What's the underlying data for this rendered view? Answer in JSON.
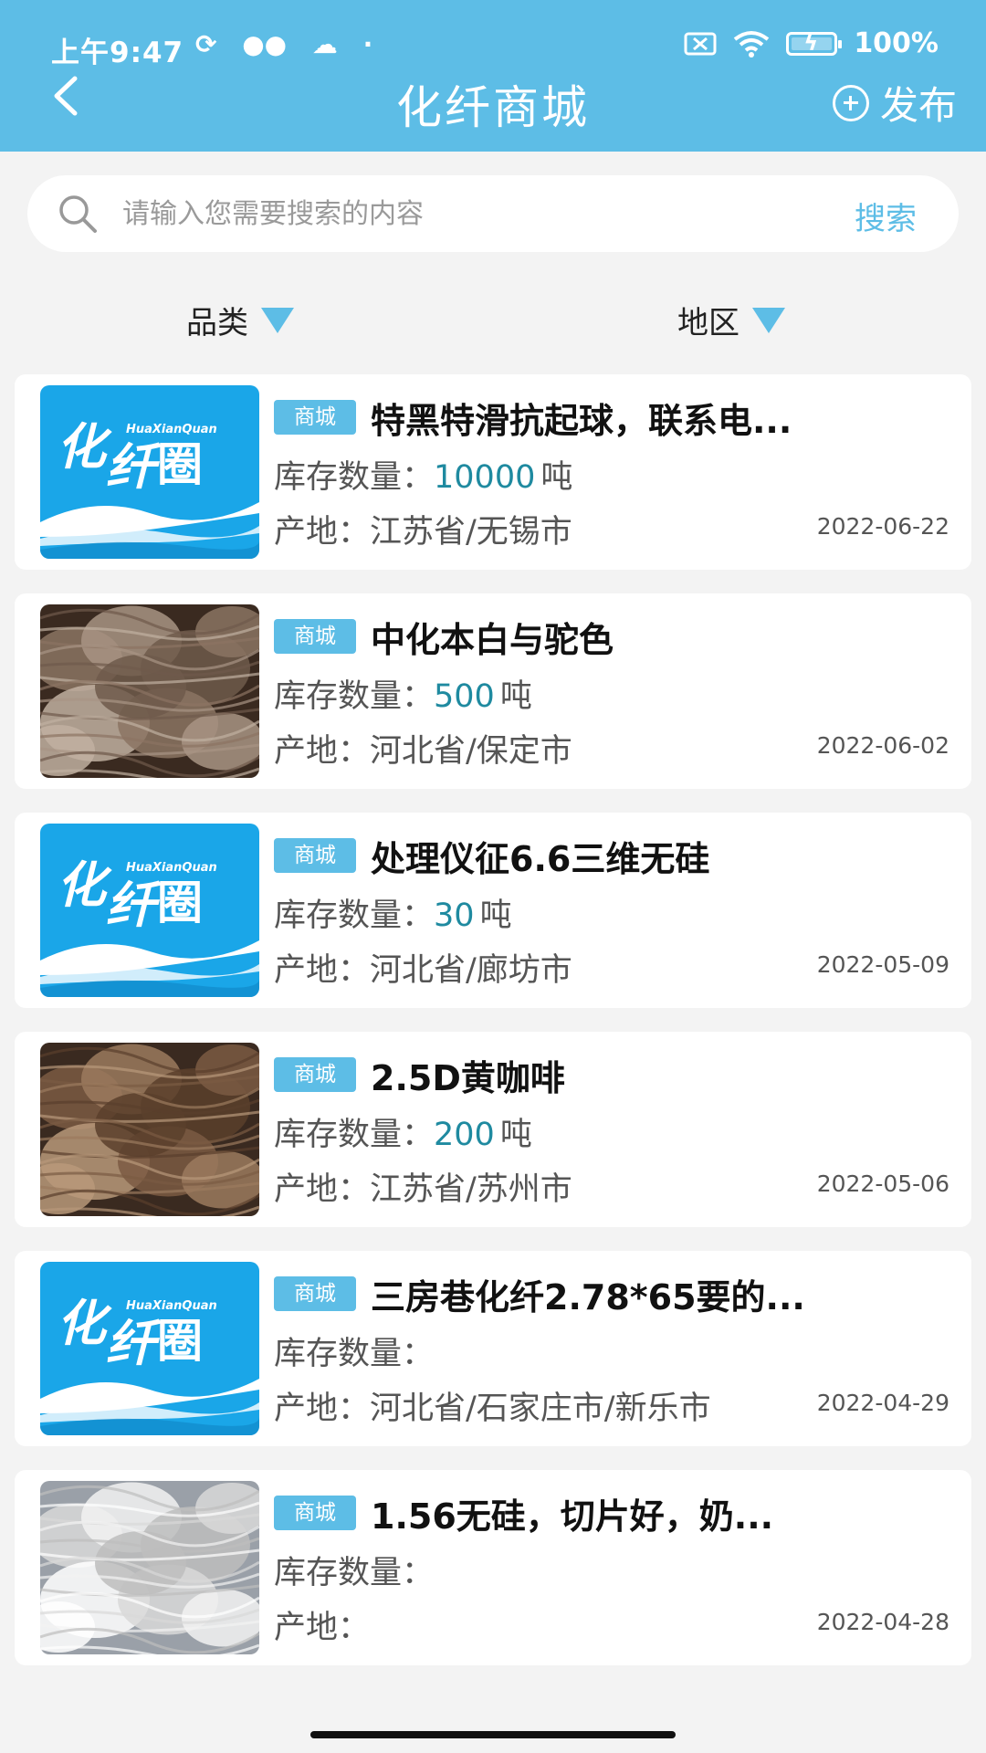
{
  "status_bar": {
    "time": "上午9:47",
    "extra_icons": [
      "sync-icon",
      "wechat-icon",
      "cloud-icon",
      "dot-icon"
    ],
    "battery": "100%"
  },
  "header": {
    "back_icon": "chevron-left-icon",
    "title": "化纤商城",
    "publish_label": "发布",
    "background": "#5dbde6"
  },
  "search": {
    "placeholder": "请输入您需要搜索的内容",
    "button_label": "搜索"
  },
  "filters": {
    "category_label": "品类",
    "region_label": "地区"
  },
  "colors": {
    "accent": "#5dbde6",
    "stock_value": "#1f8aa0"
  },
  "stock_label": "库存数量：",
  "origin_label": "产地：",
  "logo": {
    "main_text": "化纤圈",
    "sub_text": "HuaXianQuan"
  },
  "items": [
    {
      "tag": "商城",
      "title": "特黑特滑抗起球，联系电...",
      "stock_value": "10000",
      "stock_unit": "吨",
      "origin": "江苏省/无锡市",
      "date": "2022-06-22",
      "image": "logo"
    },
    {
      "tag": "商城",
      "title": "中化本白与驼色",
      "stock_value": "500",
      "stock_unit": "吨",
      "origin": "河北省/保定市",
      "date": "2022-06-02",
      "image": "fiber-brown"
    },
    {
      "tag": "商城",
      "title": "处理仪征6.6三维无硅",
      "stock_value": "30",
      "stock_unit": "吨",
      "origin": "河北省/廊坊市",
      "date": "2022-05-09",
      "image": "logo"
    },
    {
      "tag": "商城",
      "title": "2.5D黄咖啡",
      "stock_value": "200",
      "stock_unit": "吨",
      "origin": "江苏省/苏州市",
      "date": "2022-05-06",
      "image": "fiber-coffee"
    },
    {
      "tag": "商城",
      "title": "三房巷化纤2.78*65要的...",
      "stock_value": "",
      "stock_unit": "",
      "origin": "河北省/石家庄市/新乐市",
      "date": "2022-04-29",
      "image": "logo"
    },
    {
      "tag": "商城",
      "title": "1.56无硅，切片好，奶...",
      "stock_value": "",
      "stock_unit": "",
      "origin": "",
      "date": "2022-04-28",
      "image": "fiber-white"
    }
  ]
}
